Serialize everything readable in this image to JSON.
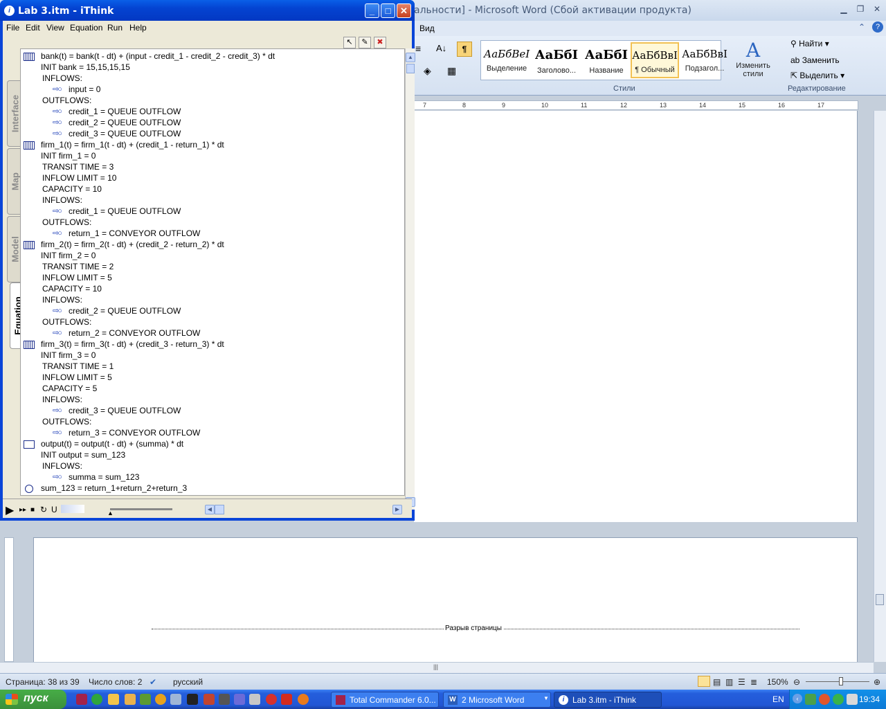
{
  "word": {
    "title": "альности] - Microsoft Word (Сбой активации продукта)",
    "menu_view": "Вид",
    "styles": [
      {
        "sample": "АаБбВеI",
        "label": "Выделение"
      },
      {
        "sample": "АаБбI",
        "label": "Заголово..."
      },
      {
        "sample": "АаБбI",
        "label": "Название"
      },
      {
        "sample": "АаБбВвI",
        "label": "¶ Обычный"
      },
      {
        "sample": "АаБбВвI",
        "label": "Подзагол..."
      }
    ],
    "change_styles_label": "Изменить стили",
    "styles_group_label": "Стили",
    "editing": {
      "find": "Найти",
      "replace": "Заменить",
      "select": "Выделить",
      "group_label": "Редактирование"
    },
    "ruler_numbers": [
      "7",
      "8",
      "9",
      "10",
      "11",
      "12",
      "13",
      "14",
      "15",
      "16",
      "17"
    ],
    "page_break_label": "Разрыв страницы",
    "status": {
      "page": "Страница: 38 из 39",
      "words": "Число слов: 2",
      "language": "русский",
      "zoom": "150%"
    }
  },
  "ithink": {
    "title": "Lab 3.itm - iThink",
    "menu": [
      "File",
      "Edit",
      "View",
      "Equation",
      "Run",
      "Help"
    ],
    "tabs": [
      "Interface",
      "Map",
      "Model",
      "Equation"
    ],
    "active_tab": "Equation",
    "equations": [
      {
        "kind": "stock-conveyor",
        "indent": 0,
        "text": "bank(t) = bank(t - dt) + (input - credit_1 - credit_2 - credit_3) * dt"
      },
      {
        "kind": "none",
        "indent": 1,
        "text": "INIT bank = 15,15,15,15"
      },
      {
        "kind": "none",
        "indent": 2,
        "text": "INFLOWS:"
      },
      {
        "kind": "flow",
        "indent": 3,
        "text": "input = 0"
      },
      {
        "kind": "none",
        "indent": 2,
        "text": "OUTFLOWS:"
      },
      {
        "kind": "flow",
        "indent": 3,
        "text": "credit_1 = QUEUE OUTFLOW"
      },
      {
        "kind": "flow",
        "indent": 3,
        "text": "credit_2 = QUEUE OUTFLOW"
      },
      {
        "kind": "flow",
        "indent": 3,
        "text": "credit_3 = QUEUE OUTFLOW"
      },
      {
        "kind": "stock-conveyor",
        "indent": 0,
        "text": "firm_1(t) = firm_1(t - dt) + (credit_1 - return_1) * dt"
      },
      {
        "kind": "none",
        "indent": 1,
        "text": "INIT firm_1 = 0"
      },
      {
        "kind": "none",
        "indent": 2,
        "text": "TRANSIT TIME = 3"
      },
      {
        "kind": "none",
        "indent": 2,
        "text": "INFLOW LIMIT = 10"
      },
      {
        "kind": "none",
        "indent": 2,
        "text": "CAPACITY = 10"
      },
      {
        "kind": "none",
        "indent": 2,
        "text": "INFLOWS:"
      },
      {
        "kind": "flow",
        "indent": 3,
        "text": "credit_1 = QUEUE OUTFLOW"
      },
      {
        "kind": "none",
        "indent": 2,
        "text": "OUTFLOWS:"
      },
      {
        "kind": "flow",
        "indent": 3,
        "text": "return_1 = CONVEYOR OUTFLOW"
      },
      {
        "kind": "stock-conveyor",
        "indent": 0,
        "text": "firm_2(t) = firm_2(t - dt) + (credit_2 - return_2) * dt"
      },
      {
        "kind": "none",
        "indent": 1,
        "text": "INIT firm_2 = 0"
      },
      {
        "kind": "none",
        "indent": 2,
        "text": "TRANSIT TIME = 2"
      },
      {
        "kind": "none",
        "indent": 2,
        "text": "INFLOW LIMIT = 5"
      },
      {
        "kind": "none",
        "indent": 2,
        "text": "CAPACITY = 10"
      },
      {
        "kind": "none",
        "indent": 2,
        "text": "INFLOWS:"
      },
      {
        "kind": "flow",
        "indent": 3,
        "text": "credit_2 = QUEUE OUTFLOW"
      },
      {
        "kind": "none",
        "indent": 2,
        "text": "OUTFLOWS:"
      },
      {
        "kind": "flow",
        "indent": 3,
        "text": "return_2 = CONVEYOR OUTFLOW"
      },
      {
        "kind": "stock-conveyor",
        "indent": 0,
        "text": "firm_3(t) = firm_3(t - dt) + (credit_3 - return_3) * dt"
      },
      {
        "kind": "none",
        "indent": 1,
        "text": "INIT firm_3 = 0"
      },
      {
        "kind": "none",
        "indent": 2,
        "text": "TRANSIT TIME = 1"
      },
      {
        "kind": "none",
        "indent": 2,
        "text": "INFLOW LIMIT = 5"
      },
      {
        "kind": "none",
        "indent": 2,
        "text": "CAPACITY = 5"
      },
      {
        "kind": "none",
        "indent": 2,
        "text": "INFLOWS:"
      },
      {
        "kind": "flow",
        "indent": 3,
        "text": "credit_3 = QUEUE OUTFLOW"
      },
      {
        "kind": "none",
        "indent": 2,
        "text": "OUTFLOWS:"
      },
      {
        "kind": "flow",
        "indent": 3,
        "text": "return_3 = CONVEYOR OUTFLOW"
      },
      {
        "kind": "stock",
        "indent": 0,
        "text": "output(t) = output(t - dt) + (summa) * dt"
      },
      {
        "kind": "none",
        "indent": 1,
        "text": "INIT output = sum_123"
      },
      {
        "kind": "none",
        "indent": 2,
        "text": "INFLOWS:"
      },
      {
        "kind": "flow",
        "indent": 3,
        "text": "summa = sum_123"
      },
      {
        "kind": "converter",
        "indent": 0,
        "text": "sum_123 = return_1+return_2+return_3"
      }
    ]
  },
  "taskbar": {
    "start": "пуск",
    "buttons": [
      "Total Commander 6.0...",
      "2 Microsoft Word",
      "Lab 3.itm - iThink"
    ],
    "active_button": "Lab 3.itm - iThink",
    "lang": "EN",
    "clock": "19:34"
  },
  "colors": {
    "xp_blue": "#0a45d8",
    "taskbar_blue": "#245edc",
    "start_green": "#3b8f3b",
    "word_frame": "#c5cfdb"
  }
}
